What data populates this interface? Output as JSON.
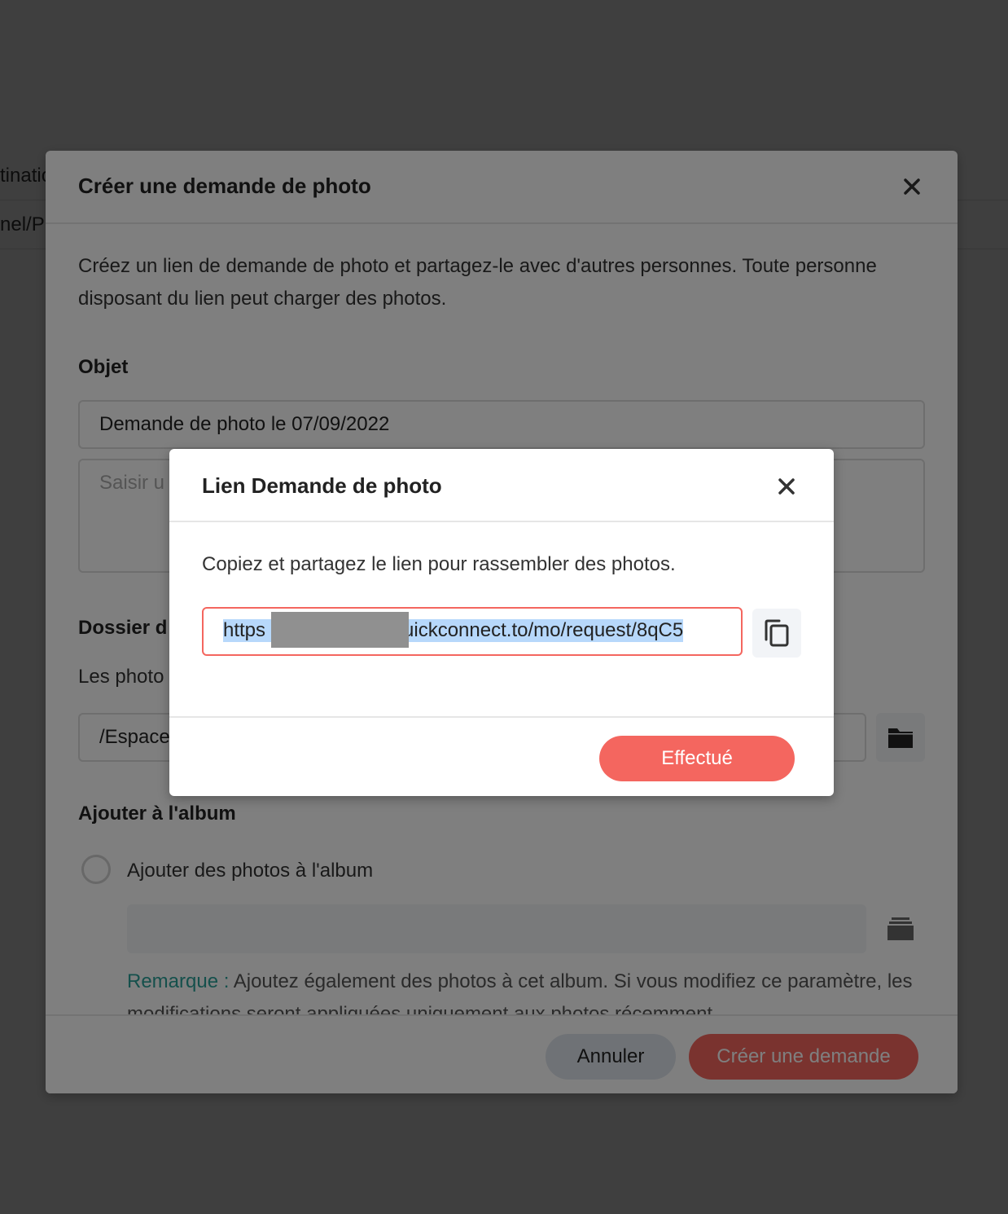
{
  "background": {
    "row1_text": "tinatio",
    "row2_text": "nel/P"
  },
  "main_dialog": {
    "title": "Créer une demande de photo",
    "description": "Créez un lien de demande de photo et partagez-le avec d'autres personnes. Toute personne disposant du lien peut charger des photos.",
    "subject_label": "Objet",
    "subject_value": "Demande de photo le 07/09/2022",
    "message_placeholder": "Saisir u",
    "folder_label": "Dossier d",
    "folder_desc": "Les photo",
    "folder_value": "/Espace",
    "album_label": "Ajouter à l'album",
    "album_option": "Ajouter des photos à l'album",
    "note_label": "Remarque :",
    "note_text": " Ajoutez également des photos à cet album. Si vous modifiez ce paramètre, les modifications seront appliquées uniquement aux photos récemment",
    "cancel_label": "Annuler",
    "create_label": "Créer une demande"
  },
  "link_dialog": {
    "title": "Lien Demande de photo",
    "description": "Copiez et partagez le lien pour rassembler des photos.",
    "link_prefix": "https",
    "link_suffix": "uickconnect.to/mo/request/8qC5",
    "done_label": "Effectué"
  }
}
